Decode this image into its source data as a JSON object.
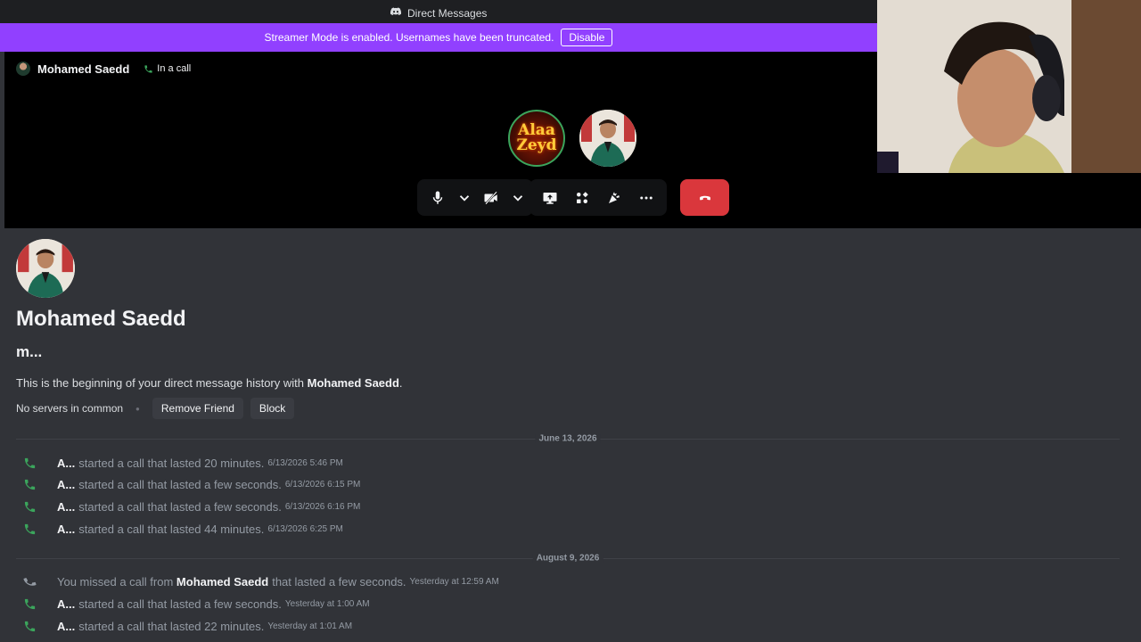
{
  "titlebar": {
    "title": "Direct Messages"
  },
  "banner": {
    "text": "Streamer Mode is enabled. Usernames have been truncated.",
    "button": "Disable",
    "color": "#9140ff"
  },
  "call": {
    "name": "Mohamed Saedd",
    "status": "In a call",
    "participants": [
      {
        "line1": "Alaa",
        "line2": "Zeyd"
      }
    ],
    "end_color": "#da373c"
  },
  "profile": {
    "name": "Mohamed Saedd",
    "tag": "m...",
    "intro_prefix": "This is the beginning of your direct message history with ",
    "intro_name": "Mohamed Saedd",
    "intro_suffix": ".",
    "servers": "No servers in common",
    "remove_friend": "Remove Friend",
    "block": "Block"
  },
  "dividers": [
    "June 13, 2026",
    "August 9, 2026"
  ],
  "log": [
    {
      "user": "A...",
      "text": "started a call that lasted 20 minutes.",
      "ts": "6/13/2026 5:46 PM",
      "missed": false
    },
    {
      "user": "A...",
      "text": "started a call that lasted a few seconds.",
      "ts": "6/13/2026 6:15 PM",
      "missed": false
    },
    {
      "user": "A...",
      "text": "started a call that lasted a few seconds.",
      "ts": "6/13/2026 6:16 PM",
      "missed": false
    },
    {
      "user": "A...",
      "text": "started a call that lasted 44 minutes.",
      "ts": "6/13/2026 6:25 PM",
      "missed": false
    },
    {
      "prefix": "You missed a call from ",
      "user": "Mohamed Saedd",
      "text": "that lasted a few seconds.",
      "ts": "Yesterday at 12:59 AM",
      "missed": true
    },
    {
      "user": "A...",
      "text": "started a call that lasted a few seconds.",
      "ts": "Yesterday at 1:00 AM",
      "missed": false
    },
    {
      "user": "A...",
      "text": "started a call that lasted 22 minutes.",
      "ts": "Yesterday at 1:01 AM",
      "missed": false
    }
  ],
  "colors": {
    "call_green": "#3ba55c",
    "missed_gray": "#949ba4"
  }
}
